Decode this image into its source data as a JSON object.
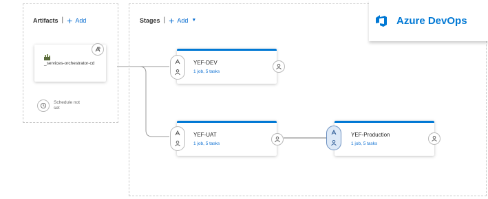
{
  "artifacts": {
    "title": "Artifacts",
    "separator": "|",
    "add_label": "Add",
    "artifact_name": "_services-orchestrator-cd",
    "schedule_label": "Schedule not set"
  },
  "stages": {
    "title": "Stages",
    "separator": "|",
    "add_label": "Add",
    "items": [
      {
        "name": "YEF-DEV",
        "summary": "1 job, 5 tasks"
      },
      {
        "name": "YEF-UAT",
        "summary": "1 job, 5 tasks"
      },
      {
        "name": "YEF-Production",
        "summary": "1 job, 5 tasks"
      }
    ]
  },
  "brand": {
    "name": "Azure DevOps",
    "color": "#0078d4"
  },
  "colors": {
    "accent": "#0078d4",
    "link": "#0a6ed1",
    "connector": "#9a9a9a"
  }
}
